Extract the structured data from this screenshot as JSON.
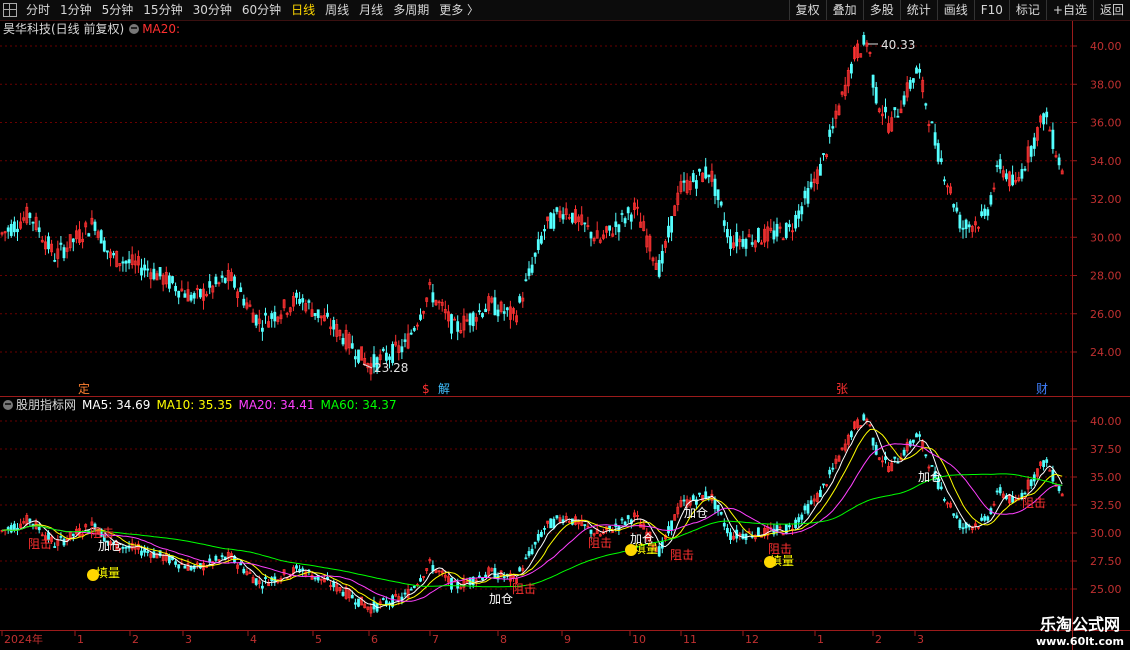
{
  "toolbar": {
    "left_items": [
      "分时",
      "1分钟",
      "5分钟",
      "15分钟",
      "30分钟",
      "60分钟",
      "日线",
      "周线",
      "月线",
      "多周期",
      "更多 〉"
    ],
    "active_item": "日线",
    "right_items": [
      "复权",
      "叠加",
      "多股",
      "统计",
      "画线",
      "F10",
      "标记",
      "+自选",
      "返回"
    ]
  },
  "main_panel": {
    "stock_title": "昊华科技(日线 前复权)",
    "ma_label": "MA20:",
    "high_annotation": "40.33",
    "low_annotation": "23.28",
    "y_ticks": [
      "40.00",
      "38.00",
      "36.00",
      "34.00",
      "32.00",
      "30.00",
      "28.00",
      "26.00",
      "24.00"
    ],
    "event_markers": [
      "定",
      "$",
      "解",
      "张",
      "财"
    ]
  },
  "indicator_panel": {
    "name": "股朋指标网",
    "ma_values": [
      {
        "label": "MA5:",
        "value": "34.69",
        "color": "#ffffff"
      },
      {
        "label": "MA10:",
        "value": "35.35",
        "color": "#ffff00"
      },
      {
        "label": "MA20:",
        "value": "34.41",
        "color": "#ff40ff"
      },
      {
        "label": "MA60:",
        "value": "34.37",
        "color": "#00ff00"
      }
    ],
    "y_ticks": [
      "40.00",
      "37.50",
      "35.00",
      "32.50",
      "30.00",
      "27.50",
      "25.00"
    ],
    "signal_labels": {
      "resist": "阻击",
      "add": "加仓",
      "fill": "填量"
    }
  },
  "time_axis": {
    "labels": [
      "2024年",
      "1",
      "2",
      "3",
      "4",
      "5",
      "6",
      "7",
      "8",
      "9",
      "10",
      "11",
      "12",
      "1",
      "2",
      "3"
    ]
  },
  "watermark": {
    "title": "乐淘公式网",
    "url": "www.60lt.com"
  },
  "colors": {
    "up": "#ff3232",
    "down": "#54ffff",
    "grid": "#6a0000",
    "axis": "#9b1b1b"
  }
}
